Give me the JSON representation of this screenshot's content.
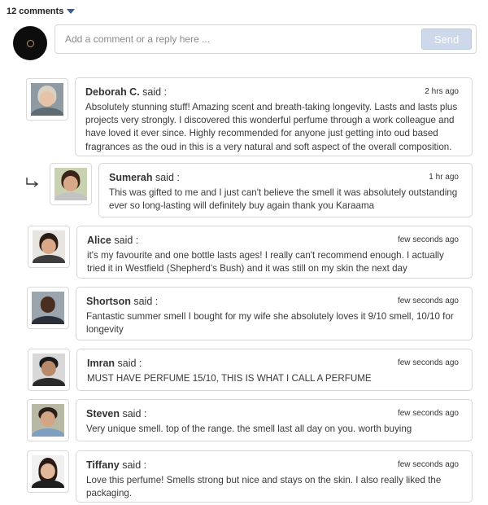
{
  "header": {
    "count_label": "12 comments"
  },
  "composer": {
    "placeholder": "Add a comment or a reply here ...",
    "send_label": "Send"
  },
  "said": "said :",
  "comments": [
    {
      "name": "Deborah C.",
      "time": "2 hrs ago",
      "text": "Absolutely stunning stuff! Amazing scent and breath-taking longevity. Lasts and lasts plus projects very strongly. I discovered this wonderful perfume through a work colleague and have loved it ever since. Highly recommended for anyone just getting into oud based fragrances as the oud in this is a very natural and soft aspect of the overall composition."
    },
    {
      "name": "Sumerah",
      "time": "1 hr ago",
      "is_reply": true,
      "text": "This was gifted to me and I just can't believe the smell it was absolutely outstanding ever so long-lasting will definitely buy again thank you Karaama"
    },
    {
      "name": "Alice",
      "time": "few seconds ago",
      "text": "it's my favourite and one bottle lasts ages! I really can't recommend enough. I actually tried it in Westfield (Shepherd's Bush) and it was still on my skin the next day"
    },
    {
      "name": "Shortson",
      "time": "few seconds ago",
      "text": "Fantastic summer smell I bought for my wife she absolutely loves it 9/10 smell, 10/10 for longevity"
    },
    {
      "name": "Imran",
      "time": "few seconds ago",
      "text": "MUST HAVE PERFUME 15/10, THIS IS WHAT I CALL A PERFUME"
    },
    {
      "name": "Steven",
      "time": "few seconds ago",
      "text": "Very unique smell. top of the range. the smell last all day on you. worth buying"
    },
    {
      "name": "Tiffany",
      "time": "few seconds ago",
      "text": "Love this perfume! Smells strong but nice and stays on the skin. I also really liked the packaging."
    }
  ]
}
